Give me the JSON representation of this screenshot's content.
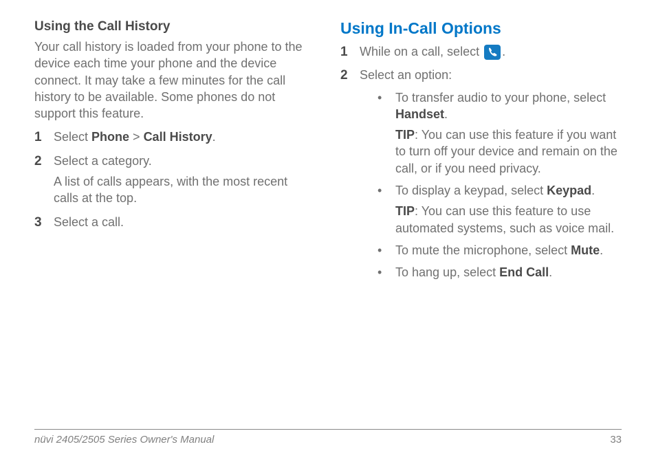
{
  "left": {
    "heading": "Using the Call History",
    "intro": "Your call history is loaded from your phone to the device each time your phone and the device connect. It may take a few minutes for the call history to be available. Some phones do not support this feature.",
    "step1_a": "Select ",
    "step1_b": "Phone",
    "step1_c": " > ",
    "step1_d": "Call History",
    "step1_e": ".",
    "step2": "Select a category.",
    "step2_cont": "A list of calls appears, with the most recent calls at the top.",
    "step3": "Select a call."
  },
  "right": {
    "heading": "Using In-Call Options",
    "step1_a": "While on a call, select ",
    "step1_b": ".",
    "step2": "Select an option:",
    "bullet1_a": "To transfer audio to your phone, select ",
    "bullet1_b": "Handset",
    "bullet1_c": ".",
    "tip1_label": "TIP",
    "tip1_text": ": You can use this feature if you want to turn off your device and remain on the call, or if you need privacy.",
    "bullet2_a": "To display a keypad, select ",
    "bullet2_b": "Keypad",
    "bullet2_c": ".",
    "tip2_label": "TIP",
    "tip2_text": ": You can use this feature to use automated systems, such as voice mail.",
    "bullet3_a": "To mute the microphone, select ",
    "bullet3_b": "Mute",
    "bullet3_c": ".",
    "bullet4_a": "To hang up, select ",
    "bullet4_b": "End Call",
    "bullet4_c": "."
  },
  "footer": {
    "title": "nüvi 2405/2505 Series Owner's Manual",
    "page": "33"
  }
}
